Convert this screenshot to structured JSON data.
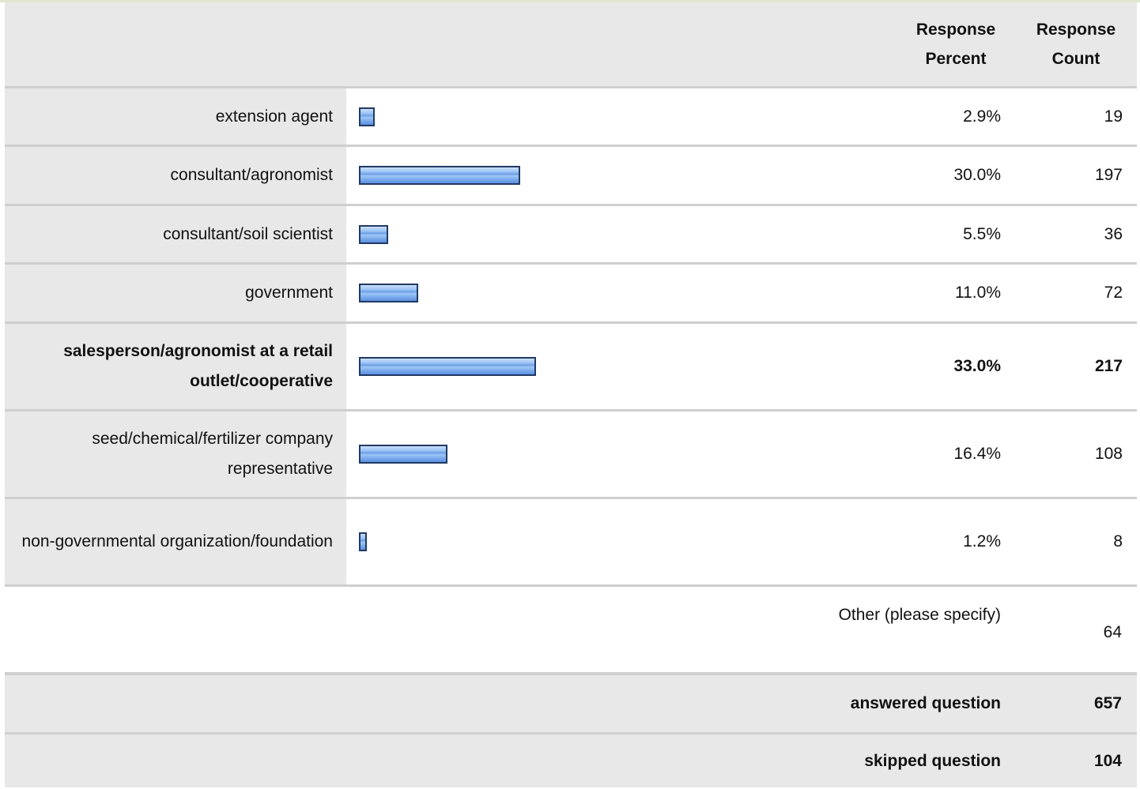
{
  "header": {
    "response_percent": "Response Percent",
    "response_count": "Response Count"
  },
  "chart_data": {
    "type": "bar",
    "categories": [
      "extension agent",
      "consultant/agronomist",
      "consultant/soil scientist",
      "government",
      "salesperson/agronomist at a retail outlet/cooperative",
      "seed/chemical/fertilizer company representative",
      "non-governmental organization/foundation"
    ],
    "series": [
      {
        "name": "Response Percent",
        "values": [
          2.9,
          30.0,
          5.5,
          11.0,
          33.0,
          16.4,
          1.2
        ]
      },
      {
        "name": "Response Count",
        "values": [
          19,
          197,
          36,
          72,
          217,
          108,
          8
        ]
      }
    ],
    "xlim": [
      0,
      100
    ],
    "grid": false
  },
  "rows": [
    {
      "label": "extension agent",
      "percent": 2.9,
      "percent_text": "2.9%",
      "count": "19",
      "emphasis": false
    },
    {
      "label": "consultant/agronomist",
      "percent": 30.0,
      "percent_text": "30.0%",
      "count": "197",
      "emphasis": false
    },
    {
      "label": "consultant/soil scientist",
      "percent": 5.5,
      "percent_text": "5.5%",
      "count": "36",
      "emphasis": false
    },
    {
      "label": "government",
      "percent": 11.0,
      "percent_text": "11.0%",
      "count": "72",
      "emphasis": false
    },
    {
      "label": "salesperson/agronomist at a retail outlet/cooperative",
      "percent": 33.0,
      "percent_text": "33.0%",
      "count": "217",
      "emphasis": true
    },
    {
      "label": "seed/chemical/fertilizer company representative",
      "percent": 16.4,
      "percent_text": "16.4%",
      "count": "108",
      "emphasis": false
    },
    {
      "label": "non-governmental organization/foundation",
      "percent": 1.2,
      "percent_text": "1.2%",
      "count": "8",
      "emphasis": false
    }
  ],
  "other": {
    "label": "Other (please specify)",
    "count": "64"
  },
  "summary": {
    "answered_label": "answered question",
    "answered_count": "657",
    "skipped_label": "skipped question",
    "skipped_count": "104"
  },
  "colors": {
    "label_background": "#e8e8e8",
    "row_border": "#cfcfcf",
    "bar_fill": "#8fbdf2",
    "bar_border": "#223a62"
  }
}
